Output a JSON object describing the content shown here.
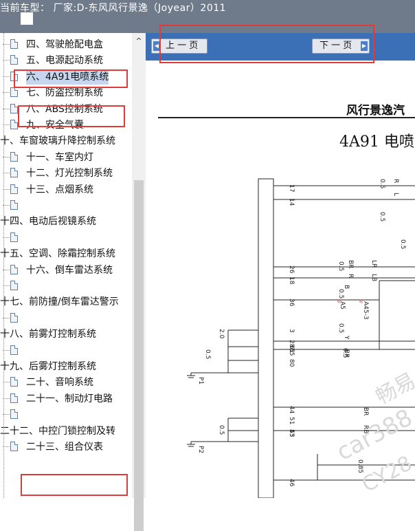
{
  "window": {
    "title": "当前车型：  厂家:D-东风风行景逸（Joyear）2011"
  },
  "tree": {
    "items": [
      {
        "label": "四、驾驶舱配电盒",
        "level": 1
      },
      {
        "label": "五、电源起动系统",
        "level": 1
      },
      {
        "label": "六、4A91电喷系统",
        "level": 1,
        "selected": true
      },
      {
        "label": "七、防盗控制系统",
        "level": 1
      },
      {
        "label": "八、ABS控制系统",
        "level": 1
      },
      {
        "label": "九、安全气囊",
        "level": 1
      },
      {
        "label": "十、车窗玻璃升降控制系统",
        "level": 0
      },
      {
        "label": "十一、车室内灯",
        "level": 1
      },
      {
        "label": "十二、灯光控制系统",
        "level": 1
      },
      {
        "label": "十三、点烟系统",
        "level": 1
      },
      {
        "label": "",
        "level": 1
      },
      {
        "label": "十四、电动后视镜系统",
        "level": 0
      },
      {
        "label": "",
        "level": 1
      },
      {
        "label": "十五、空调、除霜控制系统",
        "level": 0
      },
      {
        "label": "十六、倒车雷达系统",
        "level": 1
      },
      {
        "label": "",
        "level": 1
      },
      {
        "label": "十七、前防撞/倒车雷达警示",
        "level": 0
      },
      {
        "label": "",
        "level": 1
      },
      {
        "label": "十八、前雾灯控制系统",
        "level": 0
      },
      {
        "label": "",
        "level": 1
      },
      {
        "label": "十九、后雾灯控制系统",
        "level": 0
      },
      {
        "label": "二十、音响系统",
        "level": 1
      },
      {
        "label": "二十一、制动灯电路",
        "level": 1
      },
      {
        "label": "",
        "level": 1
      },
      {
        "label": "二十二、中控门锁控制及转",
        "level": 0
      },
      {
        "label": "二十三、组合仪表",
        "level": 1
      }
    ]
  },
  "viewer": {
    "prev_label": "上 一 页",
    "next_label": "下 一 页",
    "doc_title": "风行景逸汽",
    "sub_title": "4A91 电喷",
    "diagram_labels": {
      "pins_left": [
        "17",
        "14",
        "26",
        "18",
        "36",
        "3",
        "61",
        "80",
        "28",
        "55",
        "51",
        "53",
        "44",
        "45",
        "46"
      ],
      "grounds": [
        "P1",
        "P2"
      ],
      "wire_sizes": [
        "0.5",
        "0.5",
        "0.5",
        "0.5",
        "0.5",
        "0.5",
        "0.5",
        "0.85",
        "2.0",
        "0.5",
        "0.5"
      ],
      "codes": [
        "R",
        "L",
        "B",
        "A5",
        "A45-3",
        "BR",
        "R",
        "LR",
        "LB",
        "Y",
        "BR",
        "BR",
        "RB"
      ]
    },
    "watermark": [
      "畅易",
      "car388",
      "CY28"
    ]
  }
}
